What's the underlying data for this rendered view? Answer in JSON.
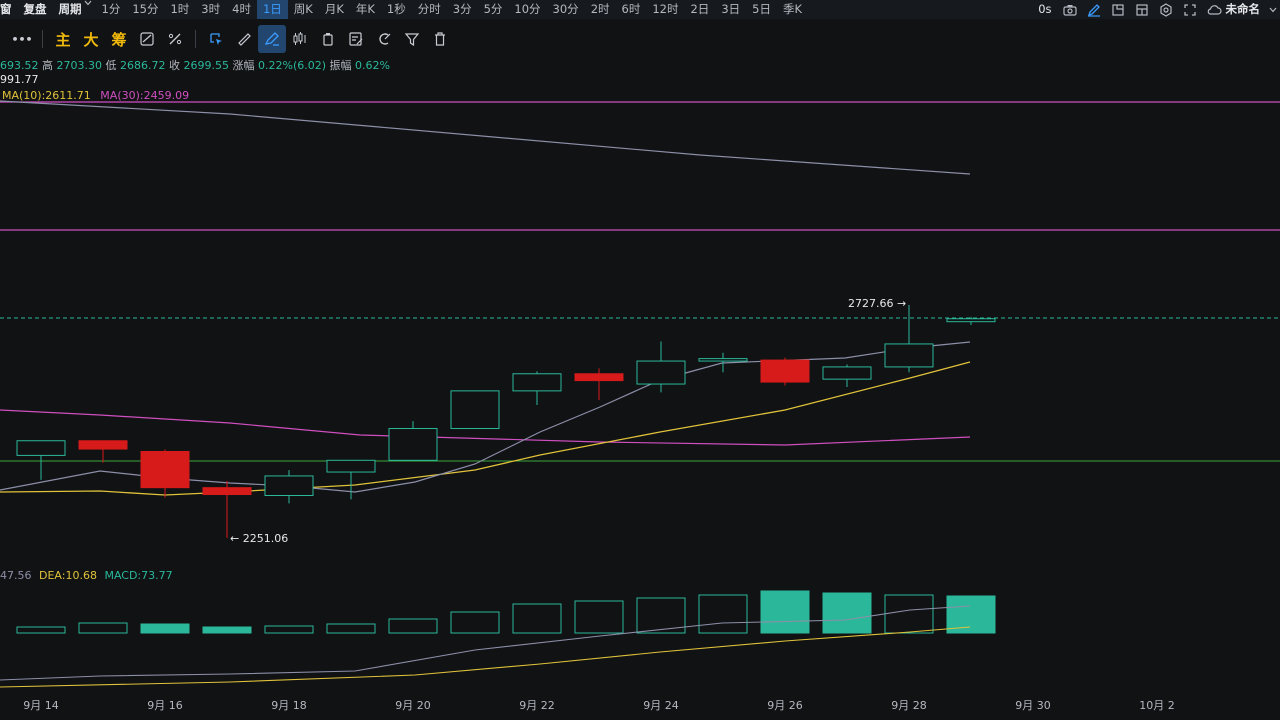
{
  "topbar": {
    "items": [
      "窗",
      "复盘",
      "周期",
      "1分",
      "15分",
      "1时",
      "3时",
      "4时",
      "1日",
      "周K",
      "月K",
      "年K",
      "1秒",
      "分时",
      "3分",
      "5分",
      "10分",
      "30分",
      "2时",
      "6时",
      "12时",
      "2日",
      "3日",
      "5日",
      "季K"
    ],
    "active": "1日",
    "countdown": "0s",
    "account": "未命名"
  },
  "toolbar": {
    "more": "•••",
    "main": "主",
    "big": "大",
    "chip": "筹"
  },
  "ohlc_row": {
    "open_partial": "693.52",
    "high_label": "高",
    "high": "2703.30",
    "low_label": "低",
    "low": "2686.72",
    "close_label": "收",
    "close": "2699.55",
    "change_label": "涨幅",
    "change": "0.22%(6.02)",
    "amplitude_label": "振幅",
    "amplitude": "0.62%"
  },
  "ma_row": {
    "partial": "991.77",
    "ma10": "MA(10):2611.71",
    "ma30": "MA(30):2459.09"
  },
  "macd_row": {
    "partial": "47.56",
    "dea": "DEA:10.68",
    "macd": "MACD:73.77"
  },
  "price_annotations": {
    "high": "2727.66",
    "low": "2251.06"
  },
  "colors": {
    "up": "#2bb89a",
    "down": "#d71a1a",
    "ma10": "#e0c23a",
    "ma30": "#d04fc0",
    "ma_gray": "#8c8fa8",
    "accent": "#3b9cff"
  },
  "chart_data": {
    "type": "candlestick",
    "x_ticks": [
      "9月 14",
      "9月 16",
      "9月 18",
      "9月 20",
      "9月 22",
      "9月 24",
      "9月 26",
      "9月 28",
      "9月 30",
      "10月 2"
    ],
    "candles": [
      {
        "o": 2420,
        "h": 2448,
        "l": 2370,
        "c": 2450,
        "dir": "up"
      },
      {
        "o": 2450,
        "h": 2450,
        "l": 2405,
        "c": 2433,
        "dir": "down"
      },
      {
        "o": 2428,
        "h": 2432,
        "l": 2334,
        "c": 2354,
        "dir": "down"
      },
      {
        "o": 2354,
        "h": 2368,
        "l": 2251.06,
        "c": 2340,
        "dir": "down"
      },
      {
        "o": 2338,
        "h": 2390,
        "l": 2322,
        "c": 2378,
        "dir": "up"
      },
      {
        "o": 2386,
        "h": 2400,
        "l": 2330,
        "c": 2410,
        "dir": "up"
      },
      {
        "o": 2410,
        "h": 2490,
        "l": 2410,
        "c": 2475,
        "dir": "up"
      },
      {
        "o": 2475,
        "h": 2540,
        "l": 2478,
        "c": 2552,
        "dir": "up"
      },
      {
        "o": 2552,
        "h": 2592,
        "l": 2523,
        "c": 2587,
        "dir": "up"
      },
      {
        "o": 2587,
        "h": 2598,
        "l": 2533,
        "c": 2573,
        "dir": "down"
      },
      {
        "o": 2566,
        "h": 2653,
        "l": 2549,
        "c": 2613,
        "dir": "up"
      },
      {
        "o": 2613,
        "h": 2630,
        "l": 2590,
        "c": 2618,
        "dir": "up"
      },
      {
        "o": 2615,
        "h": 2620,
        "l": 2563,
        "c": 2570,
        "dir": "down"
      },
      {
        "o": 2576,
        "h": 2606,
        "l": 2560,
        "c": 2601,
        "dir": "up"
      },
      {
        "o": 2601,
        "h": 2727.66,
        "l": 2590,
        "c": 2648,
        "dir": "up"
      },
      {
        "o": 2693.52,
        "h": 2703.3,
        "l": 2686.72,
        "c": 2699.55,
        "dir": "up"
      }
    ],
    "macd_hist": [
      6,
      10,
      9,
      6,
      7,
      9,
      14,
      21,
      29,
      32,
      35,
      38,
      42,
      40,
      38,
      37
    ],
    "macd_hist_filled": [
      false,
      false,
      true,
      true,
      false,
      false,
      false,
      false,
      false,
      false,
      false,
      false,
      true,
      true,
      false,
      true
    ]
  }
}
